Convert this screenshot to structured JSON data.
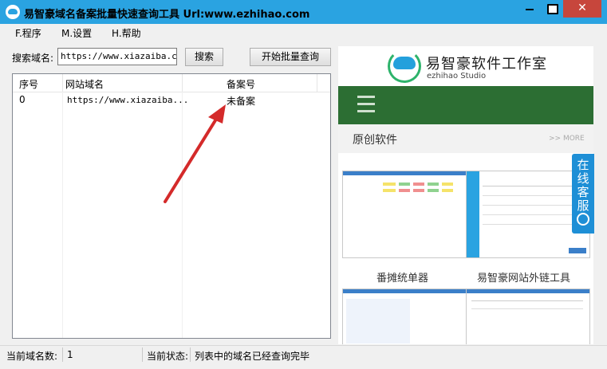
{
  "window": {
    "title": "易智豪域名备案批量快速查询工具 Url:www.ezhihao.com",
    "close_glyph": "✕"
  },
  "menu": {
    "items": [
      {
        "label": "F.程序"
      },
      {
        "label": "M.设置"
      },
      {
        "label": "H.帮助"
      }
    ]
  },
  "search": {
    "label": "搜索域名:",
    "value": "https://www.xiazaiba.com/",
    "search_button": "搜索",
    "batch_button": "开始批量查询"
  },
  "table": {
    "headers": [
      "序号",
      "网站域名",
      "备案号"
    ],
    "rows": [
      [
        "0",
        "https://www.xiazaiba...",
        "未备案"
      ]
    ]
  },
  "panel": {
    "logo_text": "易智豪软件工作室",
    "logo_sub": "ezhihao Studio",
    "section_title": "原创软件",
    "section_more": ">> MORE",
    "captions": [
      "番摊统单器",
      "易智豪网站外链工具"
    ]
  },
  "service_tab": {
    "text": "在线客服"
  },
  "status": {
    "domain_count_label": "当前域名数:",
    "domain_count": "1",
    "state_label": "当前状态:",
    "state_text": "列表中的域名已经查询完毕"
  },
  "colors": {
    "titlebar": "#2aa3e1",
    "close": "#c7463c",
    "green": "#2c6e33",
    "arrow": "#d42a2a"
  }
}
